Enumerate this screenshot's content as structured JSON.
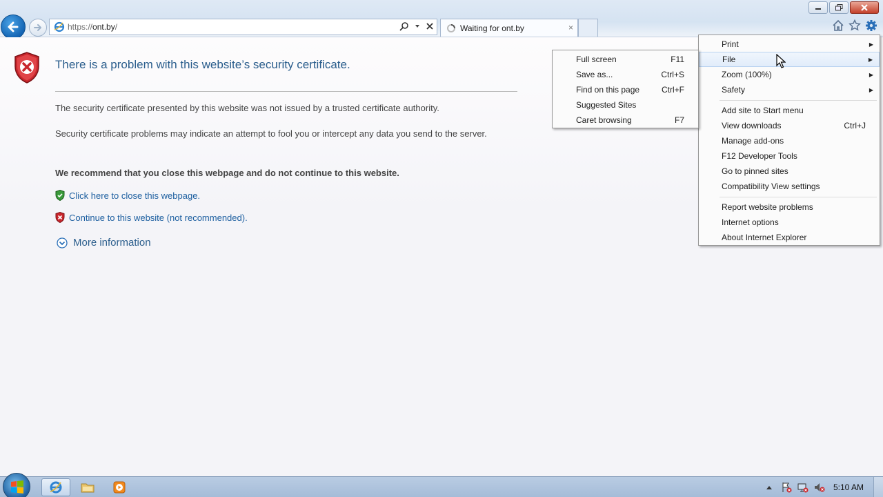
{
  "browser": {
    "address": {
      "scheme": "https://",
      "host": "ont.by",
      "path": "/"
    },
    "tab": {
      "title": "Waiting for ont.by",
      "close": "×"
    }
  },
  "page": {
    "title": "There is a problem with this website’s security certificate.",
    "p1": "The security certificate presented by this website was not issued by a trusted certificate authority.",
    "p2": "Security certificate problems may indicate an attempt to fool you or intercept any data you send to the server.",
    "p3": "We recommend that you close this webpage and do not continue to this website.",
    "link_close": "Click here to close this webpage.",
    "link_continue": "Continue to this website (not recommended).",
    "more_info": "More information"
  },
  "tools_menu": {
    "items": [
      {
        "label": "Print",
        "shortcut": "",
        "submenu": true
      },
      {
        "label": "File",
        "shortcut": "",
        "submenu": true
      },
      {
        "label": "Zoom (100%)",
        "shortcut": "",
        "submenu": true
      },
      {
        "label": "Safety",
        "shortcut": "",
        "submenu": true
      },
      {
        "label": "Add site to Start menu",
        "shortcut": ""
      },
      {
        "label": "View downloads",
        "shortcut": "Ctrl+J"
      },
      {
        "label": "Manage add-ons",
        "shortcut": ""
      },
      {
        "label": "F12 Developer Tools",
        "shortcut": ""
      },
      {
        "label": "Go to pinned sites",
        "shortcut": ""
      },
      {
        "label": "Compatibility View settings",
        "shortcut": ""
      },
      {
        "label": "Report website problems",
        "shortcut": ""
      },
      {
        "label": "Internet options",
        "shortcut": ""
      },
      {
        "label": "About Internet Explorer",
        "shortcut": ""
      }
    ]
  },
  "file_menu": {
    "items": [
      {
        "label": "Full screen",
        "shortcut": "F11"
      },
      {
        "label": "Save as...",
        "shortcut": "Ctrl+S"
      },
      {
        "label": "Find on this page",
        "shortcut": "Ctrl+F"
      },
      {
        "label": "Suggested Sites",
        "shortcut": ""
      },
      {
        "label": "Caret browsing",
        "shortcut": "F7"
      }
    ]
  },
  "taskbar": {
    "clock": "5:10 AM"
  },
  "colors": {
    "accent": "#2a5d8c",
    "link": "#1d5fa0",
    "error_red": "#c8262c"
  }
}
